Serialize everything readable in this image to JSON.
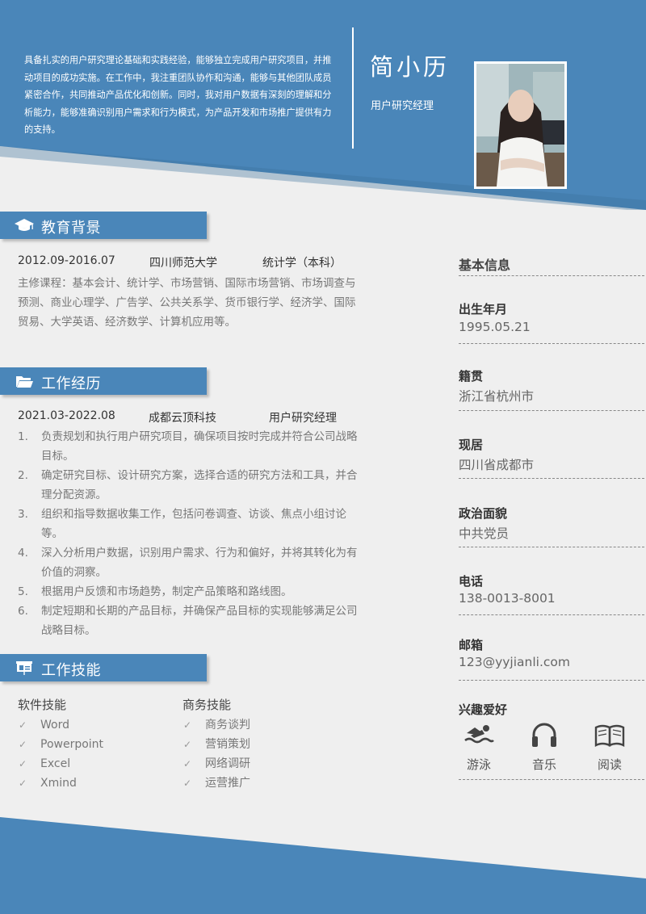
{
  "header": {
    "summary": "具备扎实的用户研究理论基础和实践经验，能够独立完成用户研究项目，并推动项目的成功实施。在工作中，我注重团队协作和沟通，能够与其他团队成员紧密合作，共同推动产品优化和创新。同时，我对用户数据有深刻的理解和分析能力，能够准确识别用户需求和行为模式，为产品开发和市场推广提供有力的支持。",
    "name": "简小历",
    "job_title": "用户研究经理"
  },
  "education": {
    "title": "教育背景",
    "period": "2012.09-2016.07",
    "school": "四川师范大学",
    "major": "统计学（本科）",
    "courses": "主修课程：基本会计、统计学、市场营销、国际市场营销、市场调查与预测、商业心理学、广告学、公共关系学、货币银行学、经济学、国际贸易、大学英语、经济数学、计算机应用等。"
  },
  "work": {
    "title": "工作经历",
    "period": "2021.03-2022.08",
    "company": "成都云顶科技",
    "position": "用户研究经理",
    "duties": [
      {
        "num": "1.",
        "text": "负责规划和执行用户研究项目，确保项目按时完成并符合公司战略目标。"
      },
      {
        "num": "2.",
        "text": "确定研究目标、设计研究方案，选择合适的研究方法和工具，并合理分配资源。"
      },
      {
        "num": "3.",
        "text": "组织和指导数据收集工作，包括问卷调查、访谈、焦点小组讨论等。"
      },
      {
        "num": "4.",
        "text": "深入分析用户数据，识别用户需求、行为和偏好，并将其转化为有价值的洞察。"
      },
      {
        "num": "5.",
        "text": "根据用户反馈和市场趋势，制定产品策略和路线图。"
      },
      {
        "num": "6.",
        "text": "制定短期和长期的产品目标，并确保产品目标的实现能够满足公司战略目标。"
      }
    ]
  },
  "skills": {
    "title": "工作技能",
    "check": "✓",
    "software_title": "软件技能",
    "software": [
      "Word",
      "Powerpoint",
      "Excel",
      "Xmind"
    ],
    "business_title": "商务技能",
    "business": [
      "商务谈判",
      "营销策划",
      "网络调研",
      "运营推广"
    ]
  },
  "basic_info": {
    "title": "基本信息",
    "birth_label": "出生年月",
    "birth": "1995.05.21",
    "origin_label": "籍贯",
    "origin": "浙江省杭州市",
    "residence_label": "现居",
    "residence": "四川省成都市",
    "political_label": "政治面貌",
    "political": "中共党员",
    "phone_label": "电话",
    "phone": "138-0013-8001",
    "email_label": "邮箱",
    "email": "123@yyjianli.com"
  },
  "hobbies": {
    "title": "兴趣爱好",
    "items": [
      {
        "label": "游泳",
        "icon": "swimming-icon"
      },
      {
        "label": "音乐",
        "icon": "headphones-icon"
      },
      {
        "label": "阅读",
        "icon": "book-icon"
      }
    ]
  },
  "colors": {
    "accent": "#4a86b9",
    "background": "#efefef"
  }
}
